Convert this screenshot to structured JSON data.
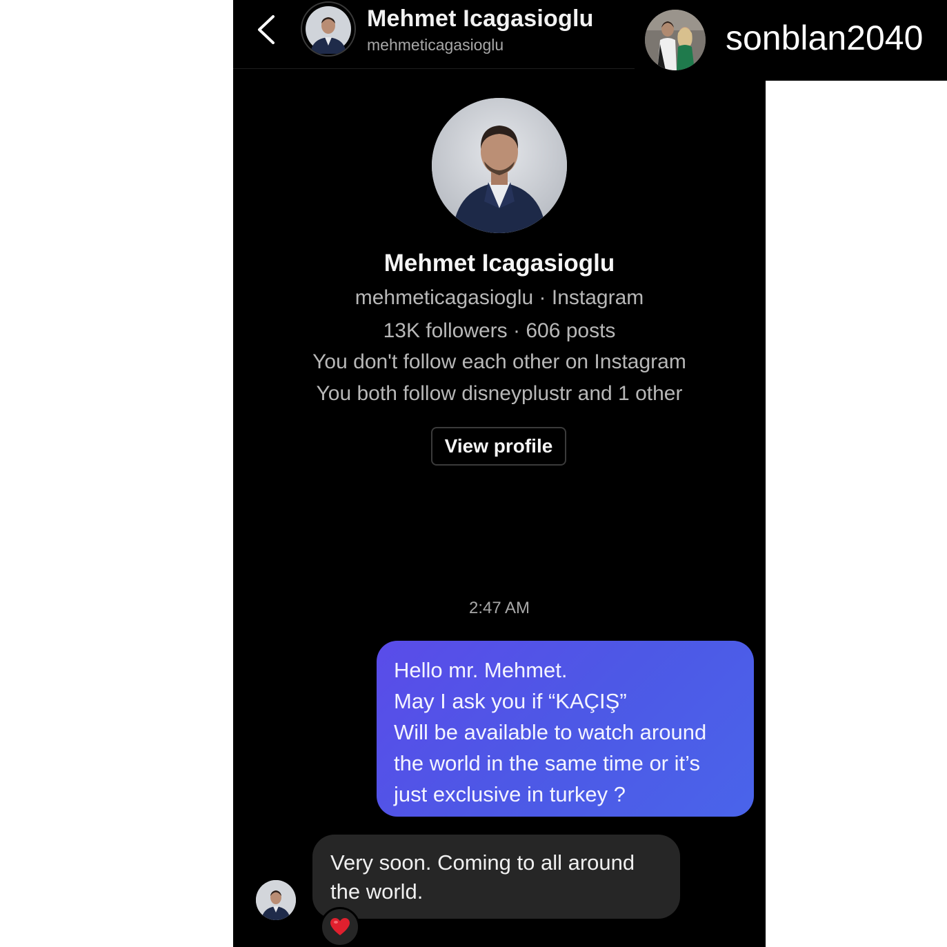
{
  "header": {
    "name": "Mehmet Icagasioglu",
    "handle": "mehmeticagasioglu"
  },
  "repost": {
    "username": "sonblan2040"
  },
  "profile": {
    "name": "Mehmet Icagasioglu",
    "source_line": "mehmeticagasioglu · Instagram",
    "stats_line": "13K followers · 606 posts",
    "follow_status": "You don't follow each other on Instagram",
    "mutual_line": "You both follow disneyplustr and 1 other",
    "view_profile_label": "View profile"
  },
  "conversation": {
    "timestamp": "2:47 AM",
    "sent_message": [
      "Hello mr. Mehmet.",
      "May I ask you if “KAÇIŞ”",
      "Will be available to watch around",
      "the world in the same time or it’s",
      "just exclusive in turkey ?"
    ],
    "received_message": [
      "Very soon. Coming to all around",
      "the world."
    ],
    "reaction": "heart-emoji"
  },
  "colors": {
    "background": "#000000",
    "sent_bubble": "#5257e8",
    "received_bubble": "#262626",
    "heart": "#e0202e"
  }
}
